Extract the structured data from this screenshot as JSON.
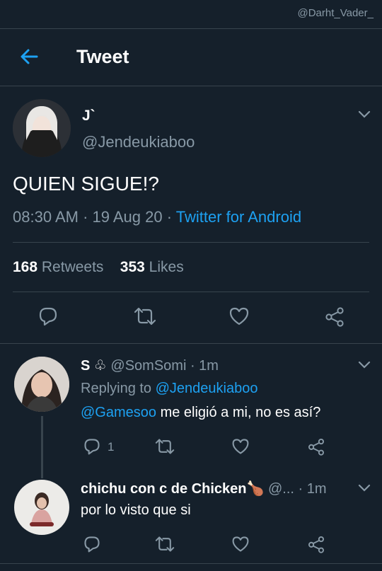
{
  "watermark": "@Darht_Vader_",
  "header": {
    "title": "Tweet"
  },
  "tweet": {
    "name": "J`",
    "handle": "@Jendeukiaboo",
    "text": "QUIEN SIGUE!?",
    "time": "08:30 AM · 19 Aug 20 ·",
    "source": "Twitter for Android",
    "retweets_count": "168",
    "retweets_label": "Retweets",
    "likes_count": "353",
    "likes_label": "Likes"
  },
  "replies": [
    {
      "name": "S ♧",
      "handle": "@SomSomi",
      "age": "· 1m",
      "replying_label": "Replying to",
      "replying_to": "@Jendeukiaboo",
      "mention": "@Gamesoo",
      "text": " me eligió a mi, no es así?",
      "reply_count": "1"
    },
    {
      "name": "chichu con c de Chicken🍗",
      "handle": "@...",
      "age": "· 1m",
      "text": "por lo visto que si"
    }
  ],
  "colors": {
    "background": "#15202b",
    "accent": "#1da1f2",
    "muted": "#8899a6",
    "divider": "#38444d"
  },
  "icons": [
    "back-arrow-icon",
    "chevron-down-icon",
    "reply-icon",
    "retweet-icon",
    "like-icon",
    "share-icon"
  ]
}
